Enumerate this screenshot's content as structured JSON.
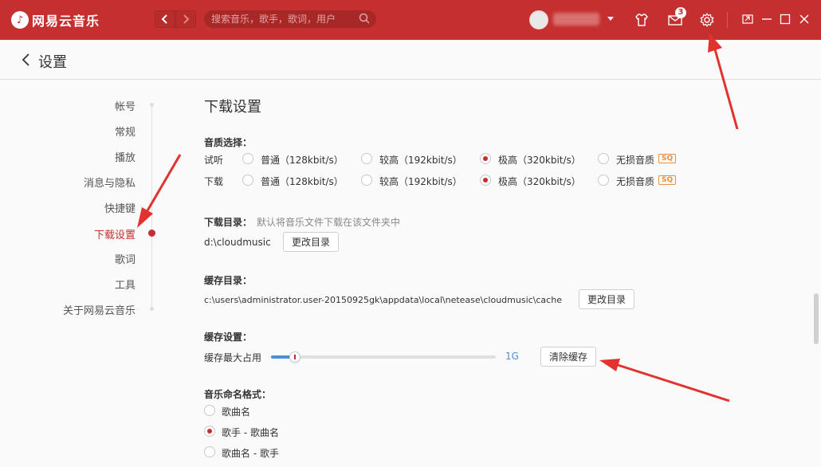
{
  "app": {
    "logo_text": "网易云音乐",
    "search_placeholder": "搜索音乐，歌手，歌词，用户",
    "messages_badge": "3"
  },
  "colors": {
    "brand": "#c62f2f",
    "accent_blue": "#4a90d9",
    "sq_orange": "#e8903a"
  },
  "header": {
    "title": "设置"
  },
  "sidebar": {
    "items": [
      {
        "label": "帐号",
        "active": false
      },
      {
        "label": "常规",
        "active": false
      },
      {
        "label": "播放",
        "active": false
      },
      {
        "label": "消息与隐私",
        "active": false
      },
      {
        "label": "快捷键",
        "active": false
      },
      {
        "label": "下载设置",
        "active": true
      },
      {
        "label": "歌词",
        "active": false
      },
      {
        "label": "工具",
        "active": false
      },
      {
        "label": "关于网易云音乐",
        "active": false
      }
    ]
  },
  "content": {
    "section_title": "下载设置",
    "quality": {
      "label": "音质选择：",
      "rows": [
        {
          "label": "试听",
          "options": [
            "普通（128kbit/s）",
            "较高（192kbit/s）",
            "极高（320kbit/s）",
            "无损音质"
          ],
          "selected": 2
        },
        {
          "label": "下载",
          "options": [
            "普通（128kbit/s）",
            "较高（192kbit/s）",
            "极高（320kbit/s）",
            "无损音质"
          ],
          "selected": 2
        }
      ],
      "sq_badge": "SQ"
    },
    "download_dir": {
      "label": "下载目录：",
      "hint": "默认将音乐文件下载在该文件夹中",
      "path": "d:\\cloudmusic",
      "button": "更改目录"
    },
    "cache_dir": {
      "label": "缓存目录：",
      "path": "c:\\users\\administrator.user-20150925gk\\appdata\\local\\netease\\cloudmusic\\cache",
      "button": "更改目录"
    },
    "cache_settings": {
      "label": "缓存设置：",
      "max_label": "缓存最大占用",
      "value": "1G",
      "slider_fraction": 0.08,
      "clear_button": "清除缓存"
    },
    "naming": {
      "label": "音乐命名格式：",
      "options": [
        "歌曲名",
        "歌手 - 歌曲名",
        "歌曲名 - 歌手"
      ],
      "selected": 1
    }
  }
}
